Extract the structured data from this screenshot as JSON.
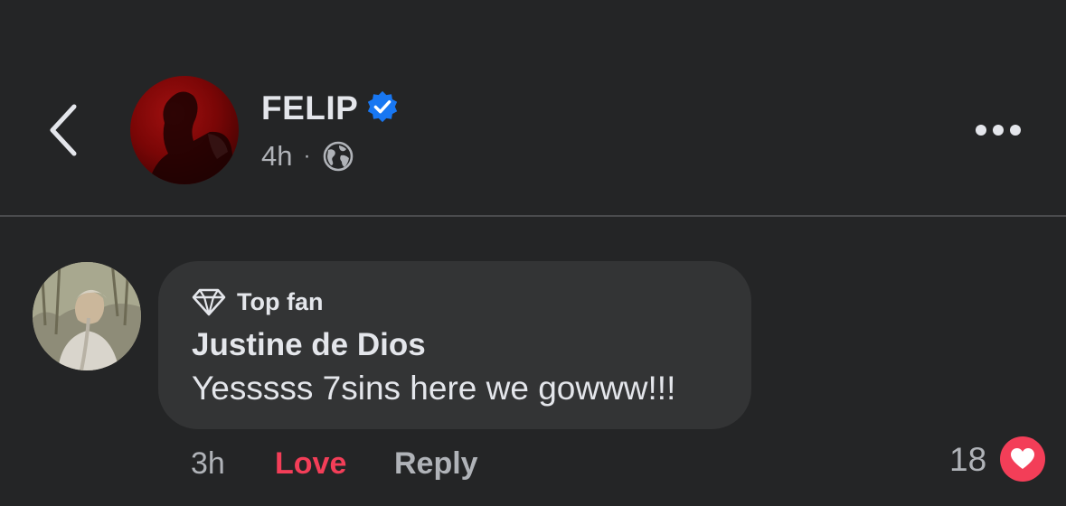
{
  "header": {
    "author_name": "FELIP",
    "verified": true,
    "post_time": "4h",
    "meta_separator": "·",
    "audience_icon": "globe-icon",
    "back_icon": "chevron-left-icon",
    "more_icon": "more-horizontal-icon"
  },
  "comment": {
    "badge_icon": "diamond-icon",
    "badge_label": "Top fan",
    "author_name": "Justine de Dios",
    "text": "Yesssss 7sins here we gowww!!!",
    "time": "3h",
    "love_label": "Love",
    "reply_label": "Reply",
    "reaction_count": "18",
    "reaction_icon": "heart-icon"
  },
  "colors": {
    "background": "#242526",
    "bubble": "#333435",
    "text_primary": "#e4e6eb",
    "text_secondary": "#b0b3b8",
    "love_red": "#f33e58",
    "verified_blue": "#1877f2",
    "divider": "#4a4b4d"
  }
}
